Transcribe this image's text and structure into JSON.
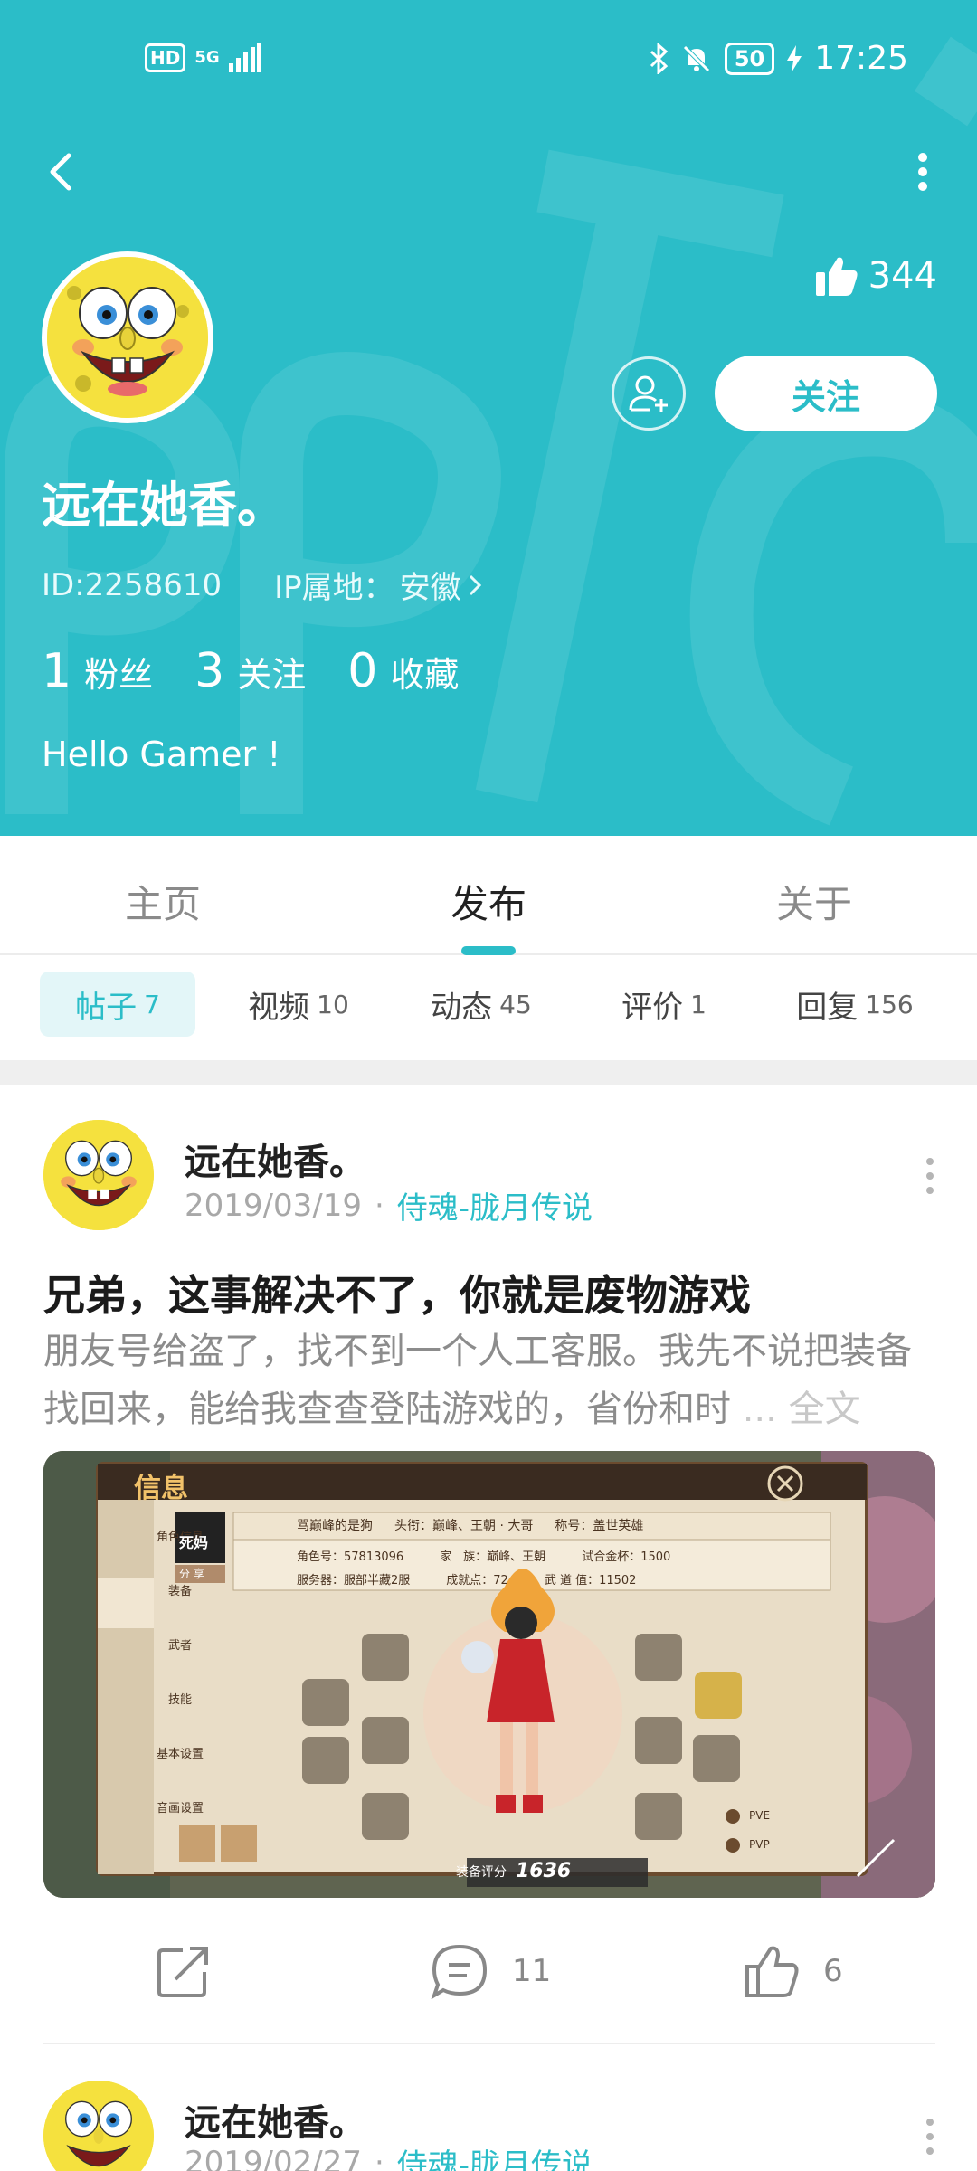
{
  "status_bar": {
    "left_badge": "HD",
    "network": "5G",
    "battery": "50",
    "time": "17:25"
  },
  "profile": {
    "likes": "344",
    "follow_label": "关注",
    "username": "远在她香。",
    "id": "ID:2258610",
    "ip_label": "IP属地：",
    "ip_value": "安徽",
    "stats": [
      {
        "num": "1",
        "label": "粉丝"
      },
      {
        "num": "3",
        "label": "关注"
      },
      {
        "num": "0",
        "label": "收藏"
      }
    ],
    "bio": "Hello Gamer !"
  },
  "main_tabs": [
    {
      "label": "主页"
    },
    {
      "label": "发布"
    },
    {
      "label": "关于"
    }
  ],
  "active_main_tab": "发布",
  "sub_tabs": [
    {
      "label": "帖子",
      "count": "7"
    },
    {
      "label": "视频",
      "count": "10"
    },
    {
      "label": "动态",
      "count": "45"
    },
    {
      "label": "评价",
      "count": "1"
    },
    {
      "label": "回复",
      "count": "156"
    }
  ],
  "posts": [
    {
      "author": "远在她香。",
      "date": "2019/03/19",
      "dot": "·",
      "game": "侍魂-胧月传说",
      "title": "兄弟，这事解决不了，你就是废物游戏",
      "body": "朋友号给盗了，找不到一个人工客服。我先不说把装备找回来，能给我查查登陆游戏的，省份和时",
      "ellipsis": "...",
      "full_text": "全文",
      "comments": "11",
      "likes": "6",
      "image": {
        "window_title": "信息",
        "tabs": [
          "角色信息",
          "装备",
          "武者",
          "技能",
          "基本设置",
          "音画设置"
        ],
        "nickname": "骂巅峰的是狗",
        "title_label": "头衔：",
        "title_value": "巅峰、王朝 · 大哥",
        "name_label": "称号：",
        "name_value": "盖世英雄",
        "role_id": "角色号：57813096",
        "family": "家　族：巅峰、王朝",
        "cup": "试合金杯：1500",
        "server": "服务器：服部半藏2服",
        "achievement": "成就点：72",
        "martial": "武 道 值：11502",
        "share": "分 享",
        "avatar_text": "死妈",
        "gear_score_label": "装备评分",
        "gear_score": "1636",
        "pve": "PVE",
        "pvp": "PVP"
      }
    },
    {
      "author": "远在她香。",
      "date": "2019/02/27",
      "dot": "·",
      "game": "侍魂-胧月传说"
    }
  ]
}
